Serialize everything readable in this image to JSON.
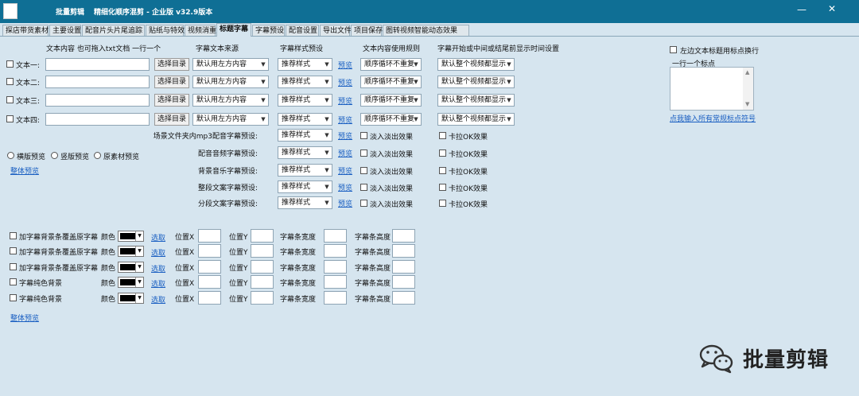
{
  "window": {
    "app_name": "批量剪辑",
    "title": "精细化顺序混剪 - 企业版   v32.9版本",
    "min_glyph": "—",
    "close_glyph": "✕"
  },
  "tabs": [
    "探店带货素材",
    "主要设置",
    "配音片头片尾追踪",
    "贴纸与特效",
    "视频消重",
    "标题字幕",
    "字幕预设",
    "配音设置",
    "导出文件名",
    "项目保存",
    "图转视频智能动态效果"
  ],
  "headers": {
    "text_content": "文本内容  也可拖入txt文档  一行一个",
    "source": "字幕文本来源",
    "style_preset": "字幕样式预设",
    "usage_rule": "文本内容使用规则",
    "time_setting": "字幕开始或中间或结尾前显示时间设置"
  },
  "text_rows": [
    {
      "label": "文本一:",
      "button": "选择目录",
      "source": "默认用左方内容",
      "style": "推荐样式",
      "preview": "预览",
      "rule": "顺序循环不重复",
      "time": "默认整个视频都显示"
    },
    {
      "label": "文本二:",
      "button": "选择目录",
      "source": "默认用左方内容",
      "style": "推荐样式",
      "preview": "预览",
      "rule": "顺序循环不重复",
      "time": "默认整个视频都显示"
    },
    {
      "label": "文本三:",
      "button": "选择目录",
      "source": "默认用左方内容",
      "style": "推荐样式",
      "preview": "预览",
      "rule": "顺序循环不重复",
      "time": "默认整个视频都显示"
    },
    {
      "label": "文本四:",
      "button": "选择目录",
      "source": "默认用左方内容",
      "style": "推荐样式",
      "preview": "预览",
      "rule": "顺序循环不重复",
      "time": "默认整个视频都显示"
    }
  ],
  "preset_rows": [
    {
      "label": "场景文件夹内mp3配音字幕预设:",
      "style": "推荐样式",
      "preview": "预览",
      "fade": "淡入淡出效果",
      "karaoke": "卡拉OK效果"
    },
    {
      "label": "配音音频字幕预设:",
      "style": "推荐样式",
      "preview": "预览",
      "fade": "淡入淡出效果",
      "karaoke": "卡拉OK效果"
    },
    {
      "label": "背景音乐字幕预设:",
      "style": "推荐样式",
      "preview": "预览",
      "fade": "淡入淡出效果",
      "karaoke": "卡拉OK效果"
    },
    {
      "label": "整段文案字幕预设:",
      "style": "推荐样式",
      "preview": "预览",
      "fade": "淡入淡出效果",
      "karaoke": "卡拉OK效果"
    },
    {
      "label": "分段文案字幕预设:",
      "style": "推荐样式",
      "preview": "预览",
      "fade": "淡入淡出效果",
      "karaoke": "卡拉OK效果"
    }
  ],
  "preview_modes": [
    "横版预览",
    "竖版预览",
    "原素材预览"
  ],
  "overall_preview": "整体预览",
  "bg_rows": [
    {
      "label": "加字幕背景条覆盖原字幕",
      "color_label": "颜色",
      "pick": "选取",
      "x": "位置X",
      "y": "位置Y",
      "w": "字幕条宽度",
      "h": "字幕条高度"
    },
    {
      "label": "加字幕背景条覆盖原字幕",
      "color_label": "颜色",
      "pick": "选取",
      "x": "位置X",
      "y": "位置Y",
      "w": "字幕条宽度",
      "h": "字幕条高度"
    },
    {
      "label": "加字幕背景条覆盖原字幕",
      "color_label": "颜色",
      "pick": "选取",
      "x": "位置X",
      "y": "位置Y",
      "w": "字幕条宽度",
      "h": "字幕条高度"
    },
    {
      "label": "字幕纯色背景",
      "color_label": "颜色",
      "pick": "选取",
      "x": "位置X",
      "y": "位置Y",
      "w": "字幕条宽度",
      "h": "字幕条高度"
    },
    {
      "label": "字幕纯色背景",
      "color_label": "颜色",
      "pick": "选取",
      "x": "位置X",
      "y": "位置Y",
      "w": "字幕条宽度",
      "h": "字幕条高度"
    }
  ],
  "overall_preview_2": "整体预览",
  "side": {
    "checkbox_label": "左边文本标题用标点换行",
    "hint": "一行一个标点",
    "link": "点我输入所有常规标点符号"
  },
  "watermark": {
    "text": "批量剪辑",
    "icon": "wechat-icon"
  },
  "colors": {
    "titlebar": "#0f6f95",
    "background": "#d6e5ef",
    "link": "#1a5fc2"
  }
}
